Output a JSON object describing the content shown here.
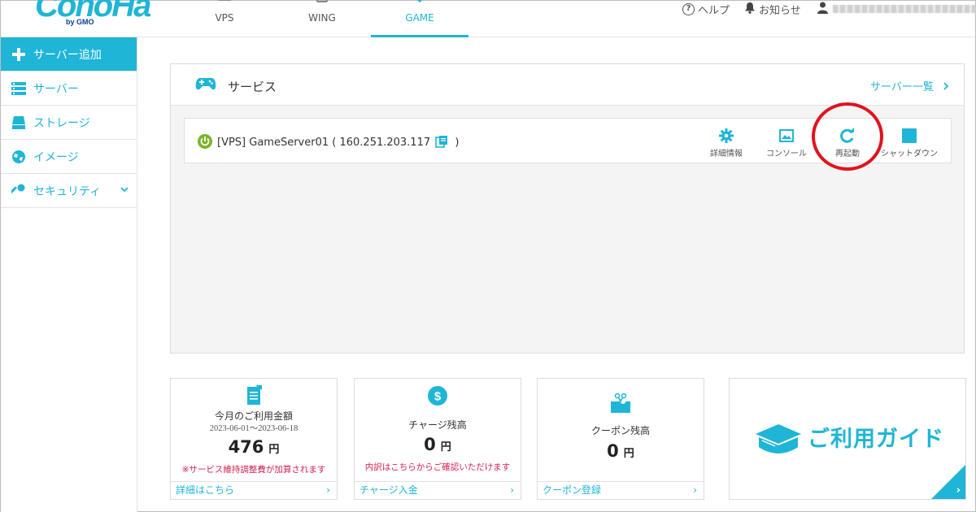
{
  "header": {
    "logo": "ConoHa",
    "logo_sub": "by GMO",
    "tabs": [
      {
        "label": "VPS",
        "icon": "server-icon"
      },
      {
        "label": "WING",
        "icon": "server-icon"
      },
      {
        "label": "GAME",
        "icon": "game-icon",
        "active": true
      }
    ],
    "help": "ヘルプ",
    "notice": "お知らせ"
  },
  "sidebar": {
    "items": [
      {
        "label": "サーバー追加",
        "icon": "plus-icon"
      },
      {
        "label": "サーバー",
        "icon": "server-list-icon"
      },
      {
        "label": "ストレージ",
        "icon": "storage-icon"
      },
      {
        "label": "イメージ",
        "icon": "image-icon"
      },
      {
        "label": "セキュリティ",
        "icon": "key-icon"
      }
    ]
  },
  "service": {
    "title": "サービス",
    "link": "サーバー一覧",
    "server_name": "[VPS] GameServer01 ( 160.251.203.117",
    "server_close": ")",
    "actions": {
      "detail": "詳細情報",
      "console": "コンソール",
      "restart": "再起動",
      "shutdown": "シャットダウン"
    }
  },
  "cards": {
    "usage": {
      "title": "今月のご利用金額",
      "period": "2023-06-01～2023-06-18",
      "amount": "476",
      "unit": "円",
      "note": "※サービス維持調整費が加算されます",
      "footer": "詳細はこちら"
    },
    "charge": {
      "title": "チャージ残高",
      "amount": "0",
      "unit": "円",
      "note": "内訳はこちらからご確認いただけます",
      "footer": "チャージ入金"
    },
    "coupon": {
      "title": "クーポン残高",
      "amount": "0",
      "unit": "円",
      "footer": "クーポン登録"
    },
    "guide": {
      "title": "ご利用ガイド"
    }
  },
  "colors": {
    "accent": "#1fb5d6",
    "power_on": "#7cb32a",
    "note_red": "#d21f4f",
    "highlight_circle": "#e0141e"
  }
}
